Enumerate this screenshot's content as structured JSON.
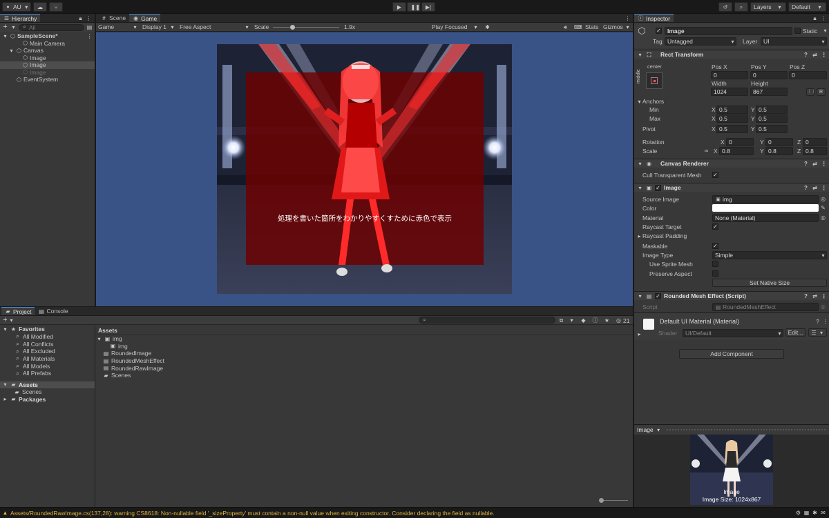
{
  "toolbar": {
    "account": "AU",
    "layers": "Layers",
    "layout": "Default"
  },
  "hierarchy": {
    "tab": "Hierarchy",
    "search_placeholder": "All",
    "items": [
      {
        "label": "SampleScene*",
        "indent": 0,
        "bold": true,
        "state": "normal"
      },
      {
        "label": "Main Camera",
        "indent": 2,
        "state": "normal"
      },
      {
        "label": "Canvas",
        "indent": 1,
        "state": "normal"
      },
      {
        "label": "Image",
        "indent": 2,
        "state": "normal"
      },
      {
        "label": "Image",
        "indent": 2,
        "state": "selected"
      },
      {
        "label": "Image",
        "indent": 2,
        "state": "disabled"
      },
      {
        "label": "EventSystem",
        "indent": 1,
        "state": "normal"
      }
    ]
  },
  "scene_tabs": [
    "Scene",
    "Game"
  ],
  "game_toolbar": {
    "mode": "Game",
    "display": "Display 1",
    "aspect": "Free Aspect",
    "scale_label": "Scale",
    "scale_value": "1.9x",
    "play_focused": "Play Focused",
    "stats": "Stats",
    "gizmos": "Gizmos"
  },
  "game_view": {
    "caption": "処理を書いた箇所をわかりやすくすために赤色で表示"
  },
  "inspector": {
    "tab": "Inspector",
    "object_name": "Image",
    "static_label": "Static",
    "tag_label": "Tag",
    "tag_value": "Untagged",
    "layer_label": "Layer",
    "layer_value": "UI",
    "rect_transform": {
      "title": "Rect Transform",
      "anchor_h": "center",
      "anchor_v": "middle",
      "posx_label": "Pos X",
      "posx": "0",
      "posy_label": "Pos Y",
      "posy": "0",
      "posz_label": "Pos Z",
      "posz": "0",
      "width_label": "Width",
      "width": "1024",
      "height_label": "Height",
      "height": "867",
      "r_button": "R",
      "anchors": "Anchors",
      "min": "Min",
      "min_x": "0.5",
      "min_y": "0.5",
      "max": "Max",
      "max_x": "0.5",
      "max_y": "0.5",
      "pivot": "Pivot",
      "pivot_x": "0.5",
      "pivot_y": "0.5",
      "rotation": "Rotation",
      "rot_x": "0",
      "rot_y": "0",
      "rot_z": "0",
      "scale": "Scale",
      "scale_x": "0.8",
      "scale_y": "0.8",
      "scale_z": "0.8",
      "x": "X",
      "y": "Y",
      "z": "Z"
    },
    "canvas_renderer": {
      "title": "Canvas Renderer",
      "cull": "Cull Transparent Mesh"
    },
    "image": {
      "title": "Image",
      "source_image": "Source Image",
      "source_value": "img",
      "color": "Color",
      "material": "Material",
      "material_value": "None (Material)",
      "raycast_target": "Raycast Target",
      "raycast_padding": "Raycast Padding",
      "maskable": "Maskable",
      "image_type": "Image Type",
      "image_type_value": "Simple",
      "use_sprite_mesh": "Use Sprite Mesh",
      "preserve_aspect": "Preserve Aspect",
      "set_native": "Set Native Size"
    },
    "rounded": {
      "title": "Rounded Mesh Effect (Script)",
      "script_label": "Script",
      "script_value": "RoundedMeshEffect"
    },
    "material": {
      "title": "Default UI Material (Material)",
      "shader_label": "Shader",
      "shader_value": "UI/Default",
      "edit": "Edit..."
    },
    "add_component": "Add Component",
    "preview": {
      "label": "Image",
      "caption_name": "Image",
      "caption_size": "Image Size: 1024x867"
    }
  },
  "project": {
    "tabs": [
      "Project",
      "Console"
    ],
    "hidden_count": "21",
    "favorites_title": "Favorites",
    "favorites": [
      "All Modified",
      "All Conflicts",
      "All Excluded",
      "All Materials",
      "All Models",
      "All Prefabs"
    ],
    "assets_root": "Assets",
    "assets_children": [
      "Scenes"
    ],
    "packages": "Packages",
    "breadcrumb": "Assets",
    "files": [
      {
        "name": "img",
        "type": "sprite",
        "indent": 0
      },
      {
        "name": "img",
        "type": "sprite-sub",
        "indent": 1
      },
      {
        "name": "RoundedImage",
        "type": "script",
        "indent": 0
      },
      {
        "name": "RoundedMeshEffect",
        "type": "script",
        "indent": 0
      },
      {
        "name": "RoundedRawImage",
        "type": "script",
        "indent": 0
      },
      {
        "name": "Scenes",
        "type": "folder",
        "indent": 0
      }
    ]
  },
  "status_bar": {
    "message": "Assets/RoundedRawImage.cs(137,28): warning CS8618: Non-nullable field '_sizeProperty' must contain a non-null value when exiting constructor. Consider declaring the field as nullable.",
    "color": "#e0b43c"
  },
  "colors": {
    "accent": "#4a90e2",
    "game_bg": "#3a5386",
    "red_overlay": "#8a0000"
  }
}
